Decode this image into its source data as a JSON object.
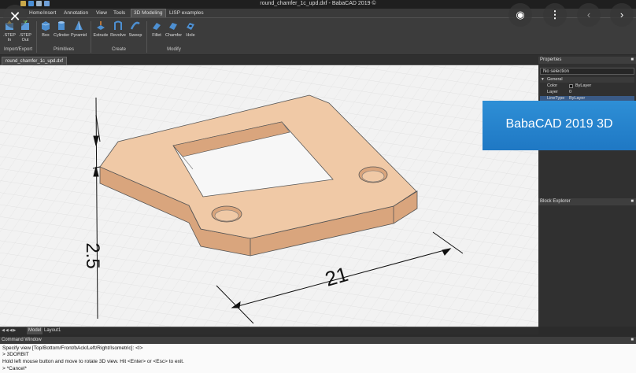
{
  "window": {
    "title": "round_chamfer_1c_upd.dxf - BabaCAD 2019 ©"
  },
  "ribbon_tabs": [
    "Home",
    "Insert",
    "Annotation",
    "View",
    "Tools",
    "3D Modeling",
    "LISP examples"
  ],
  "ribbon": {
    "import_export": {
      "label": "Import/Export",
      "buttons": [
        {
          "line1": ".STEP",
          "line2": "In"
        },
        {
          "line1": ".STEP",
          "line2": "Out"
        }
      ]
    },
    "primitives": {
      "label": "Primitives",
      "buttons": [
        "Box",
        "Cylinder",
        "Pyramid"
      ]
    },
    "create": {
      "label": "Create",
      "buttons": [
        "Extrude",
        "Revolve",
        "Sweep"
      ]
    },
    "modify": {
      "label": "Modify",
      "buttons": [
        "Fillet",
        "Chamfer",
        "Hole"
      ]
    }
  },
  "document_tab": "round_chamfer_1c_upd.dxf",
  "drawing": {
    "dim_width": "21",
    "dim_height": "2.5"
  },
  "properties": {
    "header": "Properties",
    "selection": "No selection",
    "section": "General",
    "rows": [
      {
        "key": "Color",
        "value": "ByLayer"
      },
      {
        "key": "Layer",
        "value": "0"
      },
      {
        "key": "LineType",
        "value": "ByLayer"
      }
    ]
  },
  "banner_text": "BabaCAD 2019 3D",
  "block_explorer": {
    "header": "Block Explorer"
  },
  "layout_tabs": [
    "Model",
    "Layout1"
  ],
  "command_window": {
    "header": "Command Window",
    "lines": [
      "Specify view [Top/Bottom/Front/bAck/Left/Right/Isometric]: <I>",
      "> 3DORBIT",
      "Hold left mouse button and move to rotate 3D view. Hit <Enter> or <Esc> to exit.",
      "> *Cancel*"
    ]
  },
  "colors": {
    "part_fill": "#e8bf9c",
    "part_top": "#f3d1b2",
    "banner": "#1f78c4",
    "accent": "#3a5a86"
  }
}
